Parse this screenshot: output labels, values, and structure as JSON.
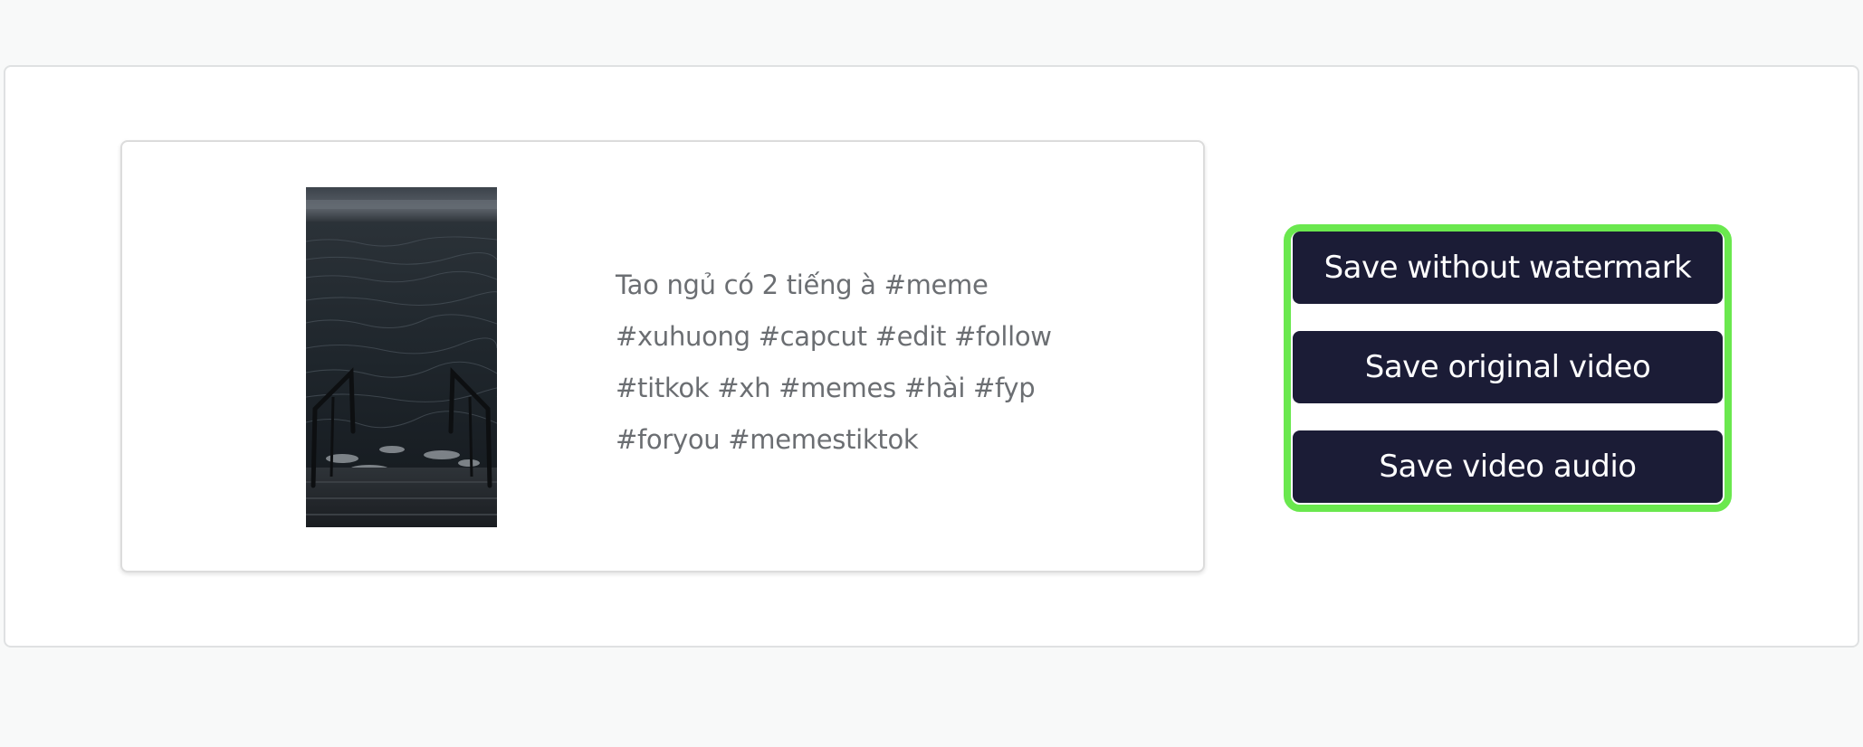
{
  "result": {
    "caption_lines": [
      "Tao ngủ có 2 tiếng à #meme",
      "#xuhuong #capcut #edit #follow",
      "#titkok #xh #memes #hài #fyp",
      "#foryou #memestiktok"
    ]
  },
  "actions": {
    "save_without_watermark": "Save without watermark",
    "save_original_video": "Save original video",
    "save_video_audio": "Save video audio"
  },
  "colors": {
    "button_bg": "#1b1c36",
    "highlight_border": "#6ae84e",
    "caption_text": "#6b6e72"
  }
}
